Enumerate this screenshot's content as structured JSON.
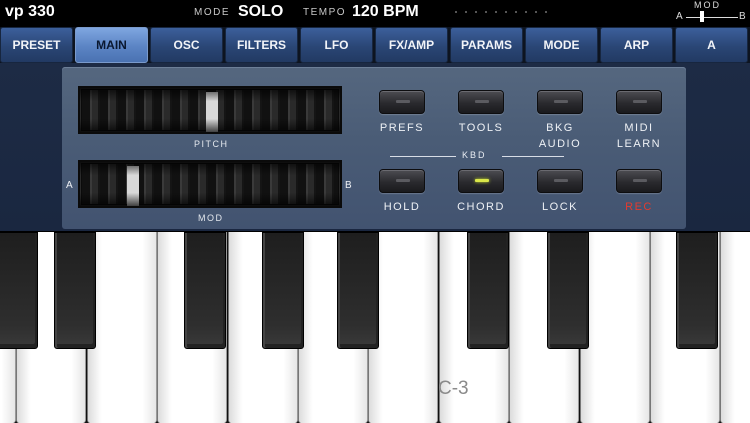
{
  "header": {
    "app_name": "vp 330",
    "mode_label": "MODE",
    "mode_value": "SOLO",
    "tempo_label": "TEMPO",
    "tempo_value": "120 BPM",
    "mod_label": "MOD",
    "mod_a": "A",
    "mod_b": "B"
  },
  "tabs": [
    {
      "label": "PRESET",
      "active": false
    },
    {
      "label": "MAIN",
      "active": true
    },
    {
      "label": "OSC",
      "active": false
    },
    {
      "label": "FILTERS",
      "active": false
    },
    {
      "label": "LFO",
      "active": false
    },
    {
      "label": "FX/AMP",
      "active": false
    },
    {
      "label": "PARAMS",
      "active": false
    },
    {
      "label": "MODE",
      "active": false
    },
    {
      "label": "ARP",
      "active": false
    },
    {
      "label": "A",
      "active": false
    }
  ],
  "wheels": {
    "pitch_label": "PITCH",
    "mod_label": "MOD",
    "mod_side_a": "A",
    "mod_side_b": "B",
    "pitch_level": 0.5,
    "mod_level": 0.18
  },
  "buttons": {
    "prefs": "PREFS",
    "tools": "TOOLS",
    "bkg_audio_line1": "BKG",
    "bkg_audio_line2": "AUDIO",
    "midi_learn_line1": "MIDI",
    "midi_learn_line2": "LEARN",
    "kbd_label": "KBD",
    "hold": "HOLD",
    "chord": "CHORD",
    "lock": "LOCK",
    "rec": "REC"
  },
  "keyboard": {
    "octave_label": "C-3"
  },
  "colors": {
    "rec_red": "#e43b2e",
    "chord_led": "#d9e64a",
    "active_tab": "#5b84c4"
  }
}
